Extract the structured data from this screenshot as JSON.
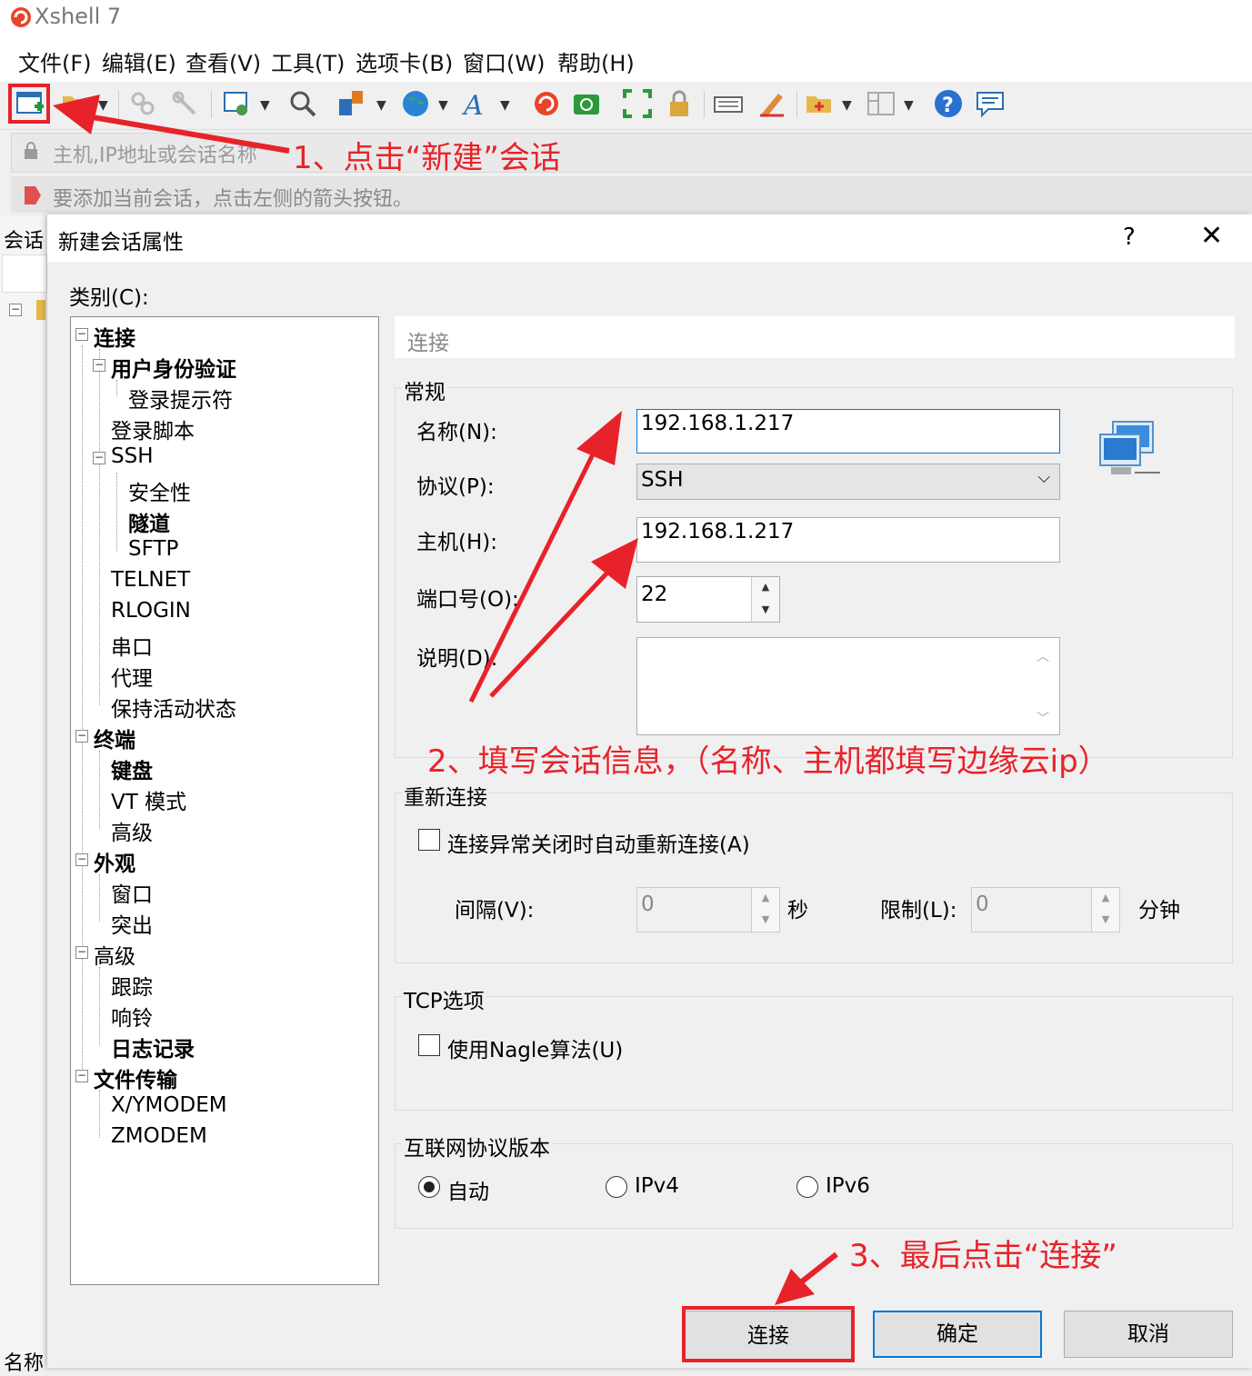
{
  "app": {
    "title": "Xshell 7"
  },
  "menu": [
    "文件(F)",
    "编辑(E)",
    "查看(V)",
    "工具(T)",
    "选项卡(B)",
    "窗口(W)",
    "帮助(H)"
  ],
  "toolbar_icons": [
    "new-session-icon",
    "open-folder-icon",
    "reconnect-icon",
    "disconnect-icon",
    "properties-icon",
    "search-icon",
    "transfer-icon",
    "globe-icon",
    "font-icon",
    "xshell-logo-icon",
    "xftp-icon",
    "fullscreen-icon",
    "lock-icon",
    "keyboard-icon",
    "highlight-icon",
    "new-folder-icon",
    "layout-icon",
    "help-icon",
    "chat-icon"
  ],
  "address_bar": {
    "placeholder": "主机,IP地址或会话名称"
  },
  "hint_bar": {
    "text": "要添加当前会话，点击左侧的箭头按钮。"
  },
  "left_pane": {
    "title": "会话",
    "footer": "名称"
  },
  "dialog": {
    "title": "新建会话属性",
    "help": "?",
    "close": "✕",
    "category_label": "类别(C):",
    "tree": [
      {
        "label": "连接",
        "bold": true,
        "level": 0
      },
      {
        "label": "用户身份验证",
        "bold": true,
        "level": 1
      },
      {
        "label": "登录提示符",
        "bold": false,
        "level": 2
      },
      {
        "label": "登录脚本",
        "bold": false,
        "level": 1
      },
      {
        "label": "SSH",
        "bold": false,
        "level": 1
      },
      {
        "label": "安全性",
        "bold": false,
        "level": 2
      },
      {
        "label": "隧道",
        "bold": true,
        "level": 2
      },
      {
        "label": "SFTP",
        "bold": false,
        "level": 2
      },
      {
        "label": "TELNET",
        "bold": false,
        "level": 1
      },
      {
        "label": "RLOGIN",
        "bold": false,
        "level": 1
      },
      {
        "label": "串口",
        "bold": false,
        "level": 1
      },
      {
        "label": "代理",
        "bold": false,
        "level": 1
      },
      {
        "label": "保持活动状态",
        "bold": false,
        "level": 1
      },
      {
        "label": "终端",
        "bold": true,
        "level": 0
      },
      {
        "label": "键盘",
        "bold": true,
        "level": 1
      },
      {
        "label": "VT 模式",
        "bold": false,
        "level": 1
      },
      {
        "label": "高级",
        "bold": false,
        "level": 1
      },
      {
        "label": "外观",
        "bold": true,
        "level": 0
      },
      {
        "label": "窗口",
        "bold": false,
        "level": 1
      },
      {
        "label": "突出",
        "bold": false,
        "level": 1
      },
      {
        "label": "高级",
        "bold": false,
        "level": 0
      },
      {
        "label": "跟踪",
        "bold": false,
        "level": 1
      },
      {
        "label": "响铃",
        "bold": false,
        "level": 1
      },
      {
        "label": "日志记录",
        "bold": true,
        "level": 1
      },
      {
        "label": "文件传输",
        "bold": true,
        "level": 0
      },
      {
        "label": "X/YMODEM",
        "bold": false,
        "level": 1
      },
      {
        "label": "ZMODEM",
        "bold": false,
        "level": 1
      }
    ],
    "section_title": "连接",
    "general": {
      "title": "常规",
      "name_label": "名称(N):",
      "name_value": "192.168.1.217",
      "protocol_label": "协议(P):",
      "protocol_value": "SSH",
      "host_label": "主机(H):",
      "host_value": "192.168.1.217",
      "port_label": "端口号(O):",
      "port_value": "22",
      "desc_label": "说明(D):",
      "desc_value": ""
    },
    "reconnect": {
      "title": "重新连接",
      "auto_label": "连接异常关闭时自动重新连接(A)",
      "auto_checked": false,
      "interval_label": "间隔(V):",
      "interval_value": "0",
      "interval_unit": "秒",
      "limit_label": "限制(L):",
      "limit_value": "0",
      "limit_unit": "分钟"
    },
    "tcp": {
      "title": "TCP选项",
      "nagle_label": "使用Nagle算法(U)",
      "nagle_checked": false
    },
    "ip_version": {
      "title": "互联网协议版本",
      "options": [
        "自动",
        "IPv4",
        "IPv6"
      ],
      "selected": "自动"
    },
    "buttons": {
      "connect": "连接",
      "ok": "确定",
      "cancel": "取消"
    }
  },
  "annotations": {
    "step1": "1、点击“新建”会话",
    "step2": "2、填写会话信息，（名称、主机都填写边缘云ip）",
    "step3": "3、最后点击“连接”",
    "color": "#e8222a"
  }
}
